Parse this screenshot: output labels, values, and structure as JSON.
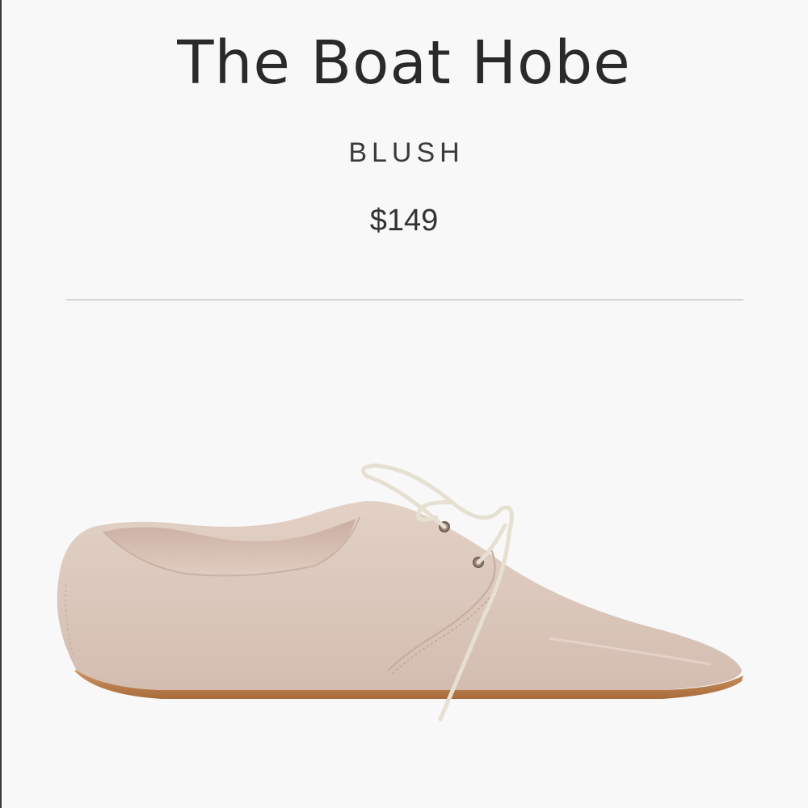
{
  "product": {
    "title": "The Boat Hobe",
    "color": "BLUSH",
    "price": "$149"
  },
  "image": {
    "subject": "shoe-icon"
  },
  "colors": {
    "background": "#f8f8f8",
    "suede": "#dcc8bc",
    "sole": "#c48a55",
    "lace": "#e2dccd",
    "text": "#2a2a2a"
  }
}
